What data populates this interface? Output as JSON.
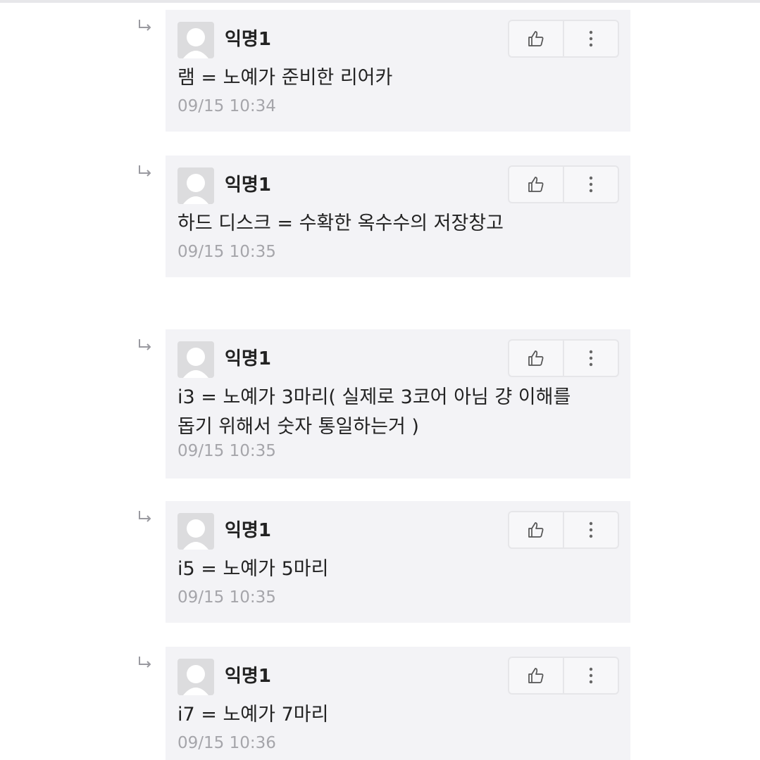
{
  "comments": [
    {
      "author": "익명1",
      "text": "램 = 노예가 준비한 리어카",
      "time": "09/15 10:34"
    },
    {
      "author": "익명1",
      "text": "하드 디스크 = 수확한 옥수수의 저장창고",
      "time": "09/15 10:35"
    },
    {
      "author": "익명1",
      "text": "i3 = 노예가 3마리( 실제로 3코어 아님 걍 이해를 돕기 위해서 숫자 통일하는거 )",
      "time": "09/15 10:35"
    },
    {
      "author": "익명1",
      "text": "i5 = 노예가 5마리",
      "time": "09/15 10:35"
    },
    {
      "author": "익명1",
      "text": "i7 = 노예가 7마리",
      "time": "09/15 10:36"
    }
  ],
  "icons": {
    "reply": "reply-arrow-icon",
    "like": "thumbs-up-icon",
    "more": "more-vertical-icon",
    "avatar": "default-avatar-icon"
  },
  "colors": {
    "card_bg": "#f3f3f6",
    "timestamp": "#a5a5aa",
    "text": "#222222"
  }
}
